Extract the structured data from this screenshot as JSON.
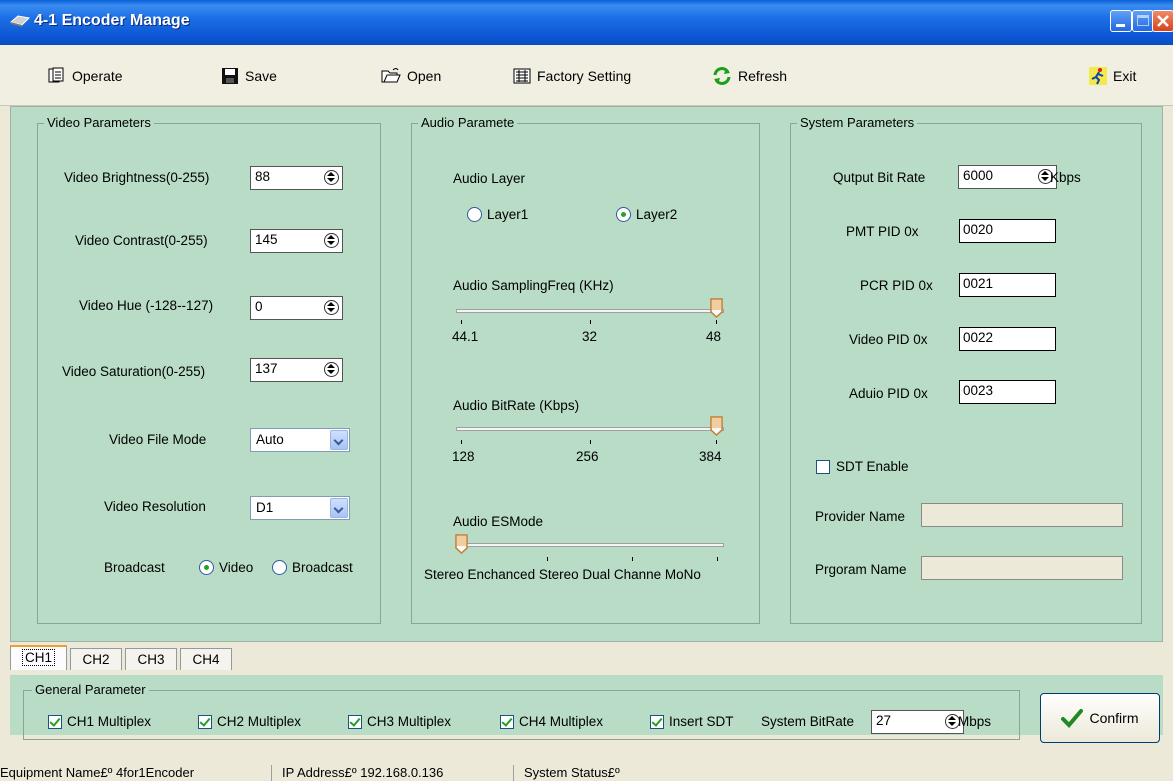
{
  "window": {
    "title": "4-1 Encoder  Manage"
  },
  "toolbar": {
    "operate": "Operate",
    "save": "Save",
    "open": "Open",
    "factory": "Factory Setting",
    "refresh": "Refresh",
    "exit": "Exit"
  },
  "video": {
    "group_title": "Video Parameters",
    "brightness_label": "Video Brightness(0-255)",
    "brightness_value": "88",
    "contrast_label": "Video Contrast(0-255)",
    "contrast_value": "145",
    "hue_label": "Video Hue (-128--127)",
    "hue_value": "0",
    "saturation_label": "Video Saturation(0-255)",
    "saturation_value": "137",
    "file_mode_label": "Video File Mode",
    "file_mode_value": "Auto",
    "resolution_label": "Video Resolution",
    "resolution_value": "D1",
    "broadcast_label": "Broadcast",
    "opt_video": "Video",
    "opt_broadcast": "Broadcast"
  },
  "audio": {
    "group_title": "Audio Paramete",
    "layer_label": "Audio Layer",
    "layer1": "Layer1",
    "layer2": "Layer2",
    "sampling_label": "Audio SamplingFreq (KHz)",
    "sampling_ticks": [
      "44.1",
      "32",
      "48"
    ],
    "sampling_value": "48",
    "bitrate_label": "Audio BitRate (Kbps)",
    "bitrate_ticks": [
      "128",
      "256",
      "384"
    ],
    "bitrate_value": "384",
    "esmode_label": "Audio ESMode",
    "esmode_ticks": "Stereo  Enchanced Stereo  Dual  Channe  MoNo",
    "esmode_value": "Stereo"
  },
  "system": {
    "group_title": "System Parameters",
    "bitrate_label": "Qutput  Bit Rate",
    "bitrate_value": "6000",
    "bitrate_unit": "Kbps",
    "pmt_label": "PMT PID 0x",
    "pmt_value": "0020",
    "pcr_label": "PCR PID 0x",
    "pcr_value": "0021",
    "video_pid_label": "Video PID 0x",
    "video_pid_value": "0022",
    "audio_pid_label": "Aduio PID 0x",
    "audio_pid_value": "0023",
    "sdt_label": "SDT  Enable",
    "provider_label": "Provider Name",
    "program_label": "Prgoram Name"
  },
  "tabs": [
    "CH1",
    "CH2",
    "CH3",
    "CH4"
  ],
  "general": {
    "group_title": "General Parameter",
    "ch1": "CH1 Multiplex",
    "ch2": "CH2 Multiplex",
    "ch3": "CH3 Multiplex",
    "ch4": "CH4 Multiplex",
    "insert_sdt": "Insert SDT",
    "sys_bitrate_label": "System BitRate",
    "sys_bitrate_value": "27",
    "sys_bitrate_unit": "Mbps",
    "confirm": "Confirm"
  },
  "status": {
    "equipment": "Equipment Name£º 4for1Encoder",
    "ip": "IP Address£º 192.168.0.136",
    "system": "System Status£º"
  }
}
